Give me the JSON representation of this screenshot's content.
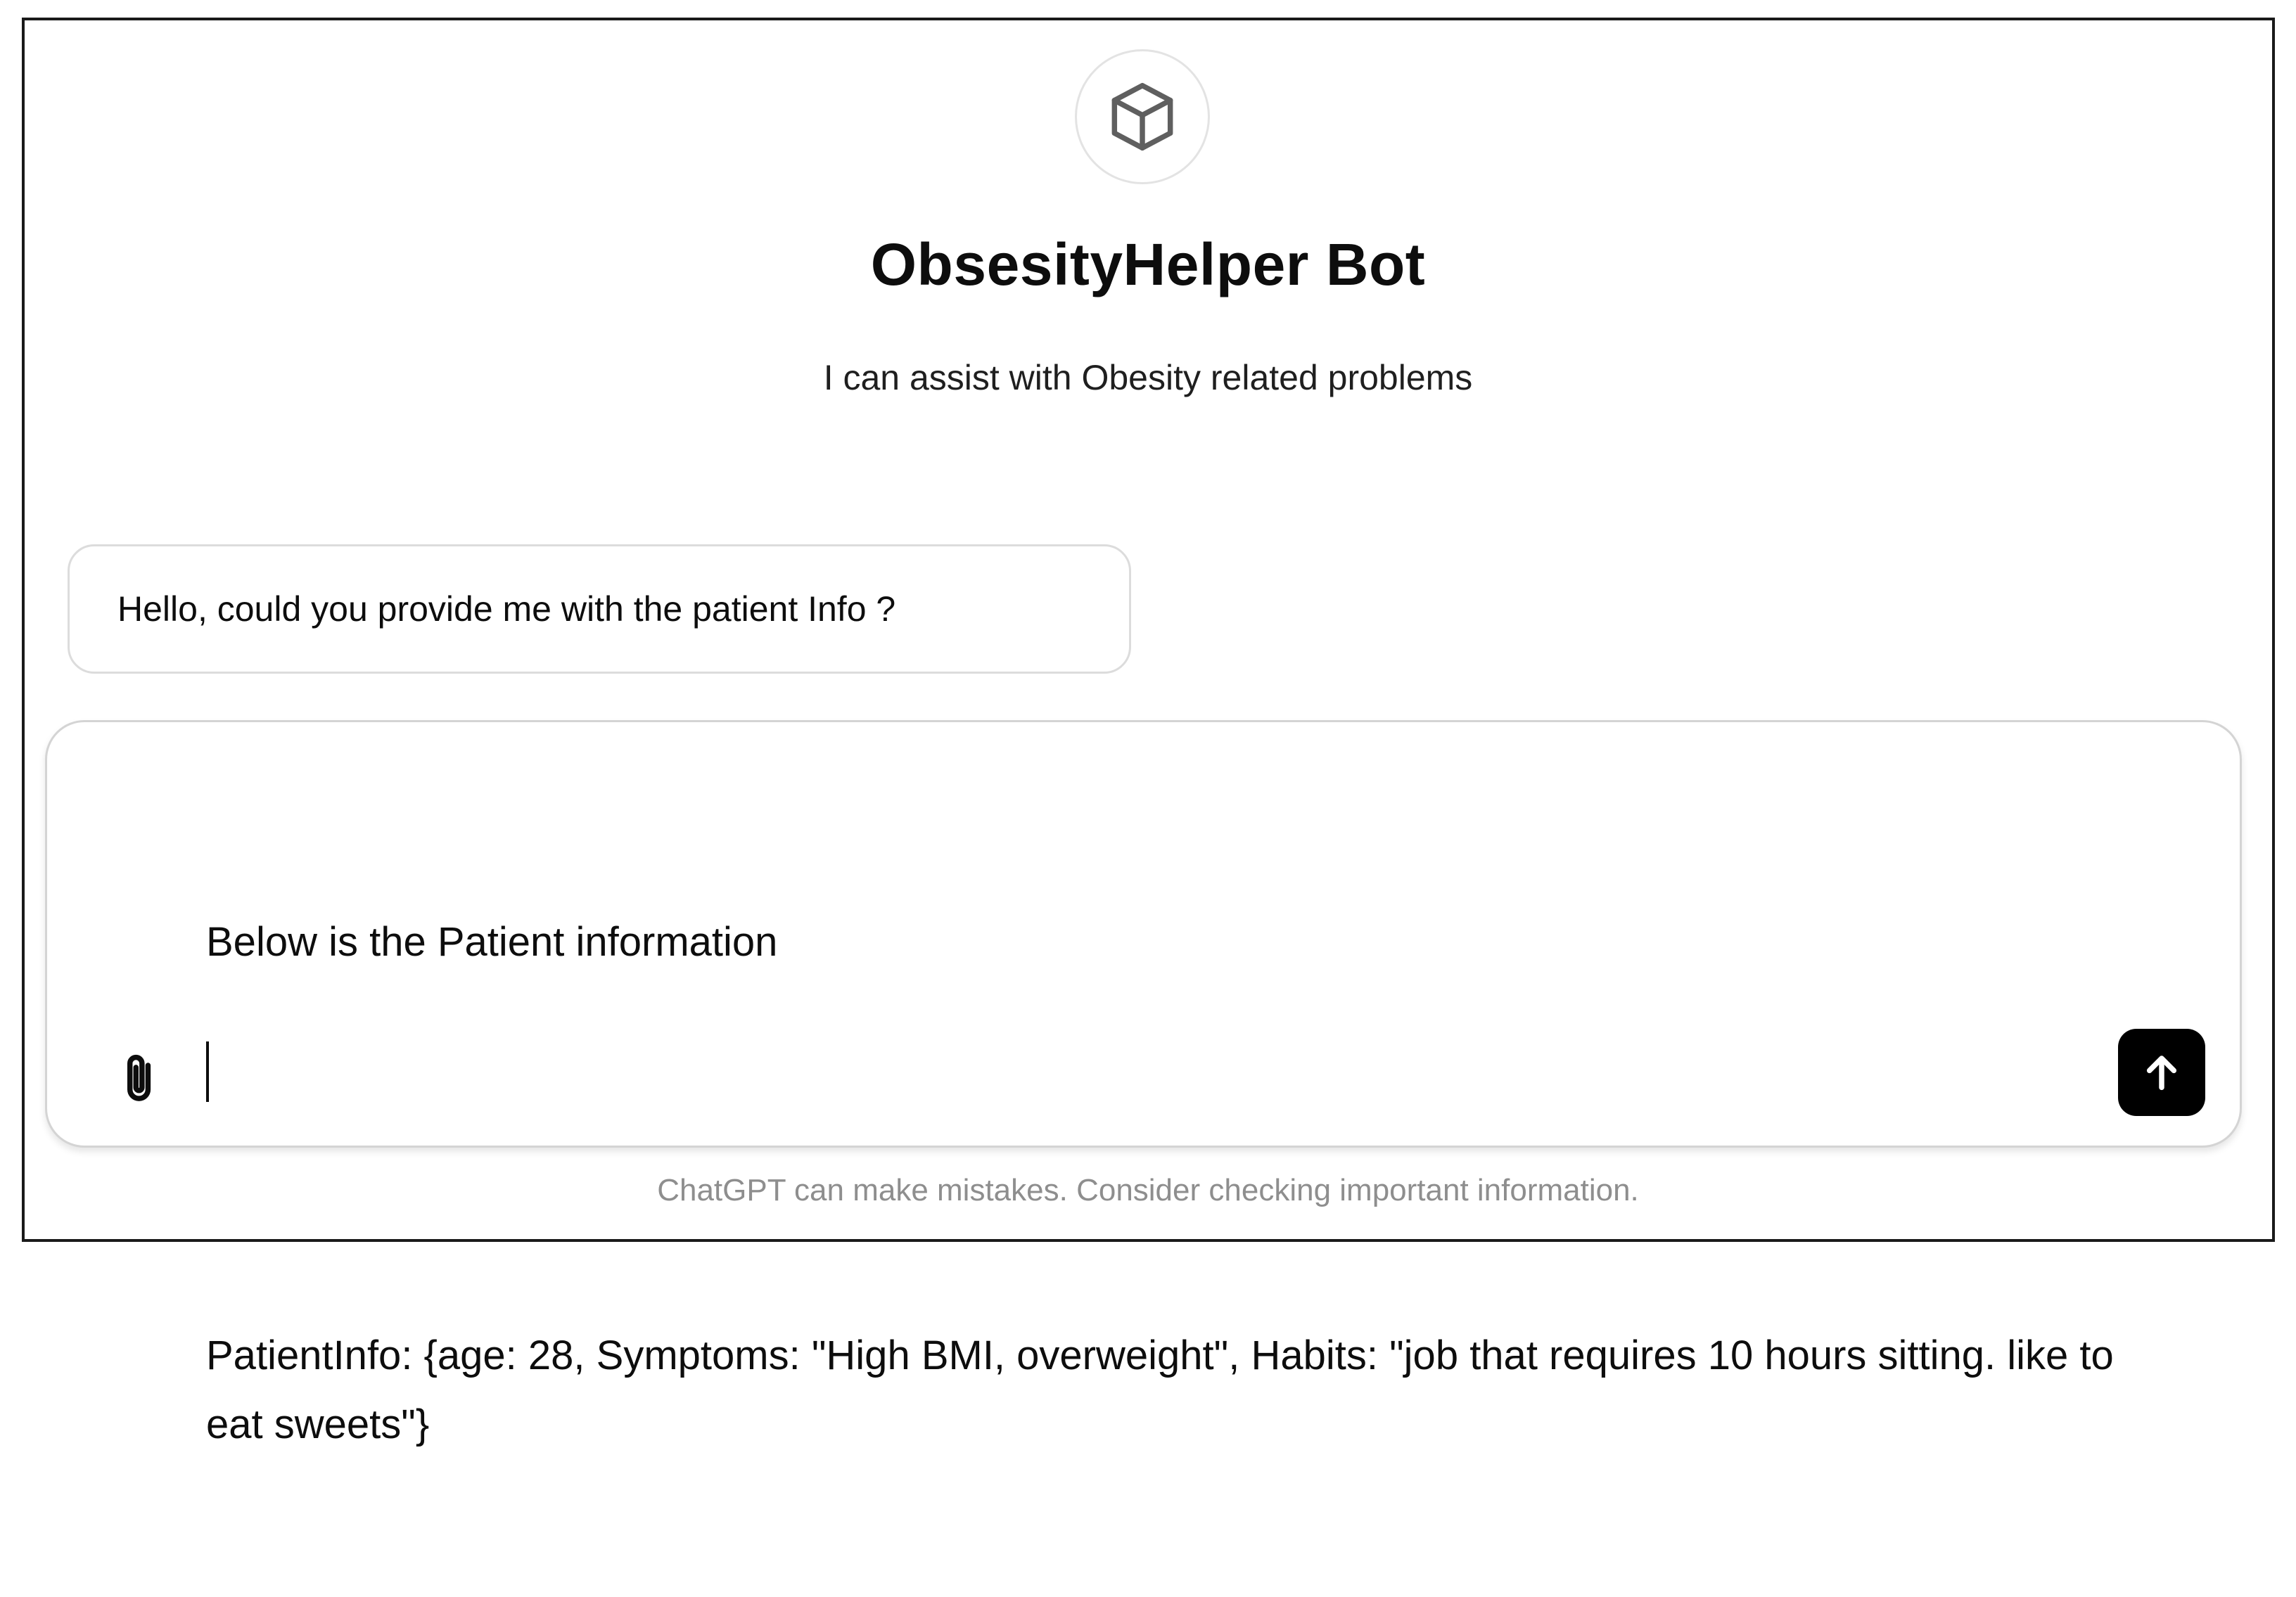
{
  "gpt": {
    "name": "ObsesityHelper Bot",
    "description": "I can assist with Obesity related problems",
    "avatar_icon": "cube-icon"
  },
  "conversation": {
    "messages": [
      {
        "role": "assistant",
        "text": "Hello, could you provide me with the patient Info ?"
      }
    ]
  },
  "composer": {
    "lines": [
      "Below is the Patient information",
      "",
      "PatientInfo: {age: 28, Symptoms: \"High BMI, overweight\", Habits: \"job that requires 10 hours sitting. like to eat sweets\"}"
    ],
    "attach_icon": "paperclip-icon",
    "send_icon": "arrow-up-icon"
  },
  "footer": {
    "disclaimer": "ChatGPT can make mistakes. Consider checking important information."
  },
  "colors": {
    "text": "#0d0d0d",
    "muted": "#8e8e8e",
    "border": "#dcdcdc",
    "send_bg": "#000000"
  }
}
